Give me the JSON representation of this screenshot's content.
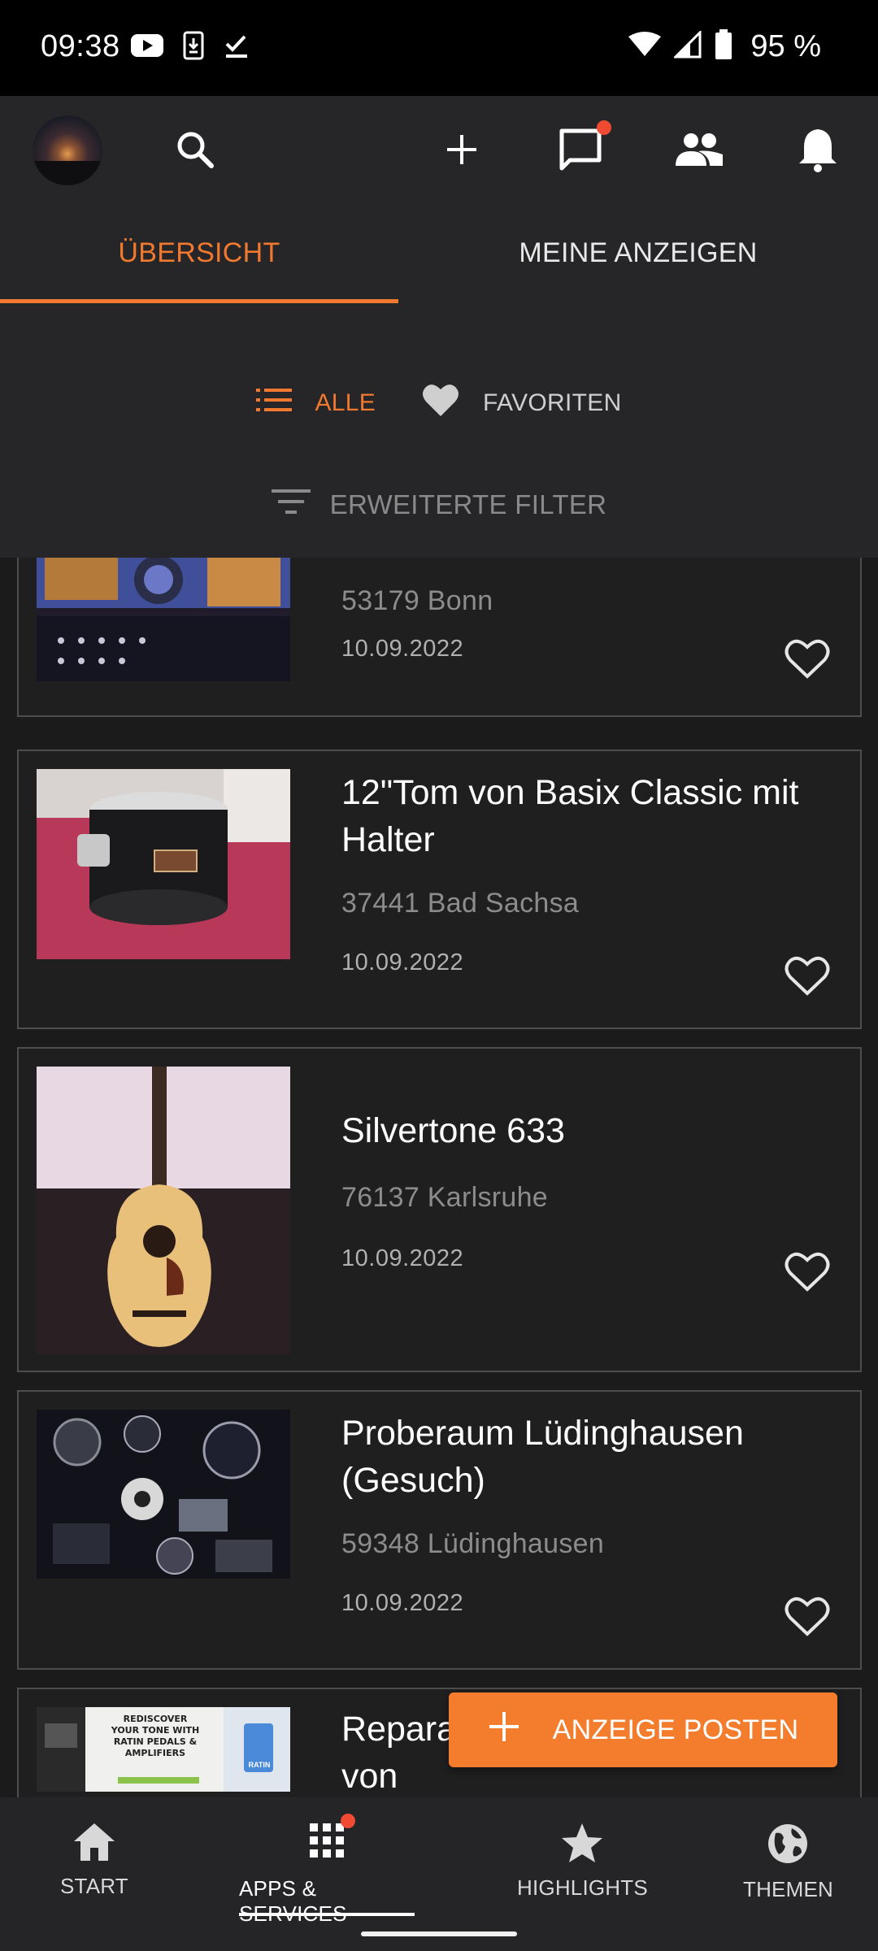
{
  "status_bar": {
    "time": "09:38",
    "battery_text": "95 %"
  },
  "app_bar": {
    "icons": [
      "avatar",
      "search-icon",
      "plus-icon",
      "chat-icon",
      "people-icon",
      "bell-icon"
    ]
  },
  "tabs": {
    "active": "ÜBERSICHT",
    "inactive": "MEINE ANZEIGEN"
  },
  "filters": {
    "all": "ALLE",
    "favorites": "FAVORITEN",
    "advanced": "ERWEITERTE FILTER"
  },
  "listings": [
    {
      "title": "",
      "location": "53179 Bonn",
      "date": "10.09.2022"
    },
    {
      "title": "12\"Tom von Basix Classic mit Halter",
      "location": "37441 Bad Sachsa",
      "date": "10.09.2022"
    },
    {
      "title": "Silvertone 633",
      "location": "76137 Karlsruhe",
      "date": "10.09.2022"
    },
    {
      "title": "Proberaum Lüdinghausen (Gesuch)",
      "location": "59348 Lüdinghausen",
      "date": "10.09.2022"
    },
    {
      "title": "Reparatur, Design und Aufbau von",
      "location": "",
      "date": ""
    }
  ],
  "ad_thumb_text": {
    "line1": "REDISCOVER",
    "line2": "YOUR TONE WITH",
    "line3": "RATIN PEDALS &",
    "line4": "AMPLIFIERS",
    "brand": "RATIN"
  },
  "fab": {
    "label": "ANZEIGE POSTEN"
  },
  "bottom_nav": {
    "items": [
      {
        "label": "START",
        "icon": "home-icon"
      },
      {
        "label": "APPS & SERVICES",
        "icon": "apps-grid-icon"
      },
      {
        "label": "HIGHLIGHTS",
        "icon": "star-icon"
      },
      {
        "label": "THEMEN",
        "icon": "globe-icon"
      }
    ]
  },
  "colors": {
    "accent": "#f0792f",
    "background": "#1b1b1c",
    "surface": "#262628",
    "badge": "#ee4b32"
  }
}
